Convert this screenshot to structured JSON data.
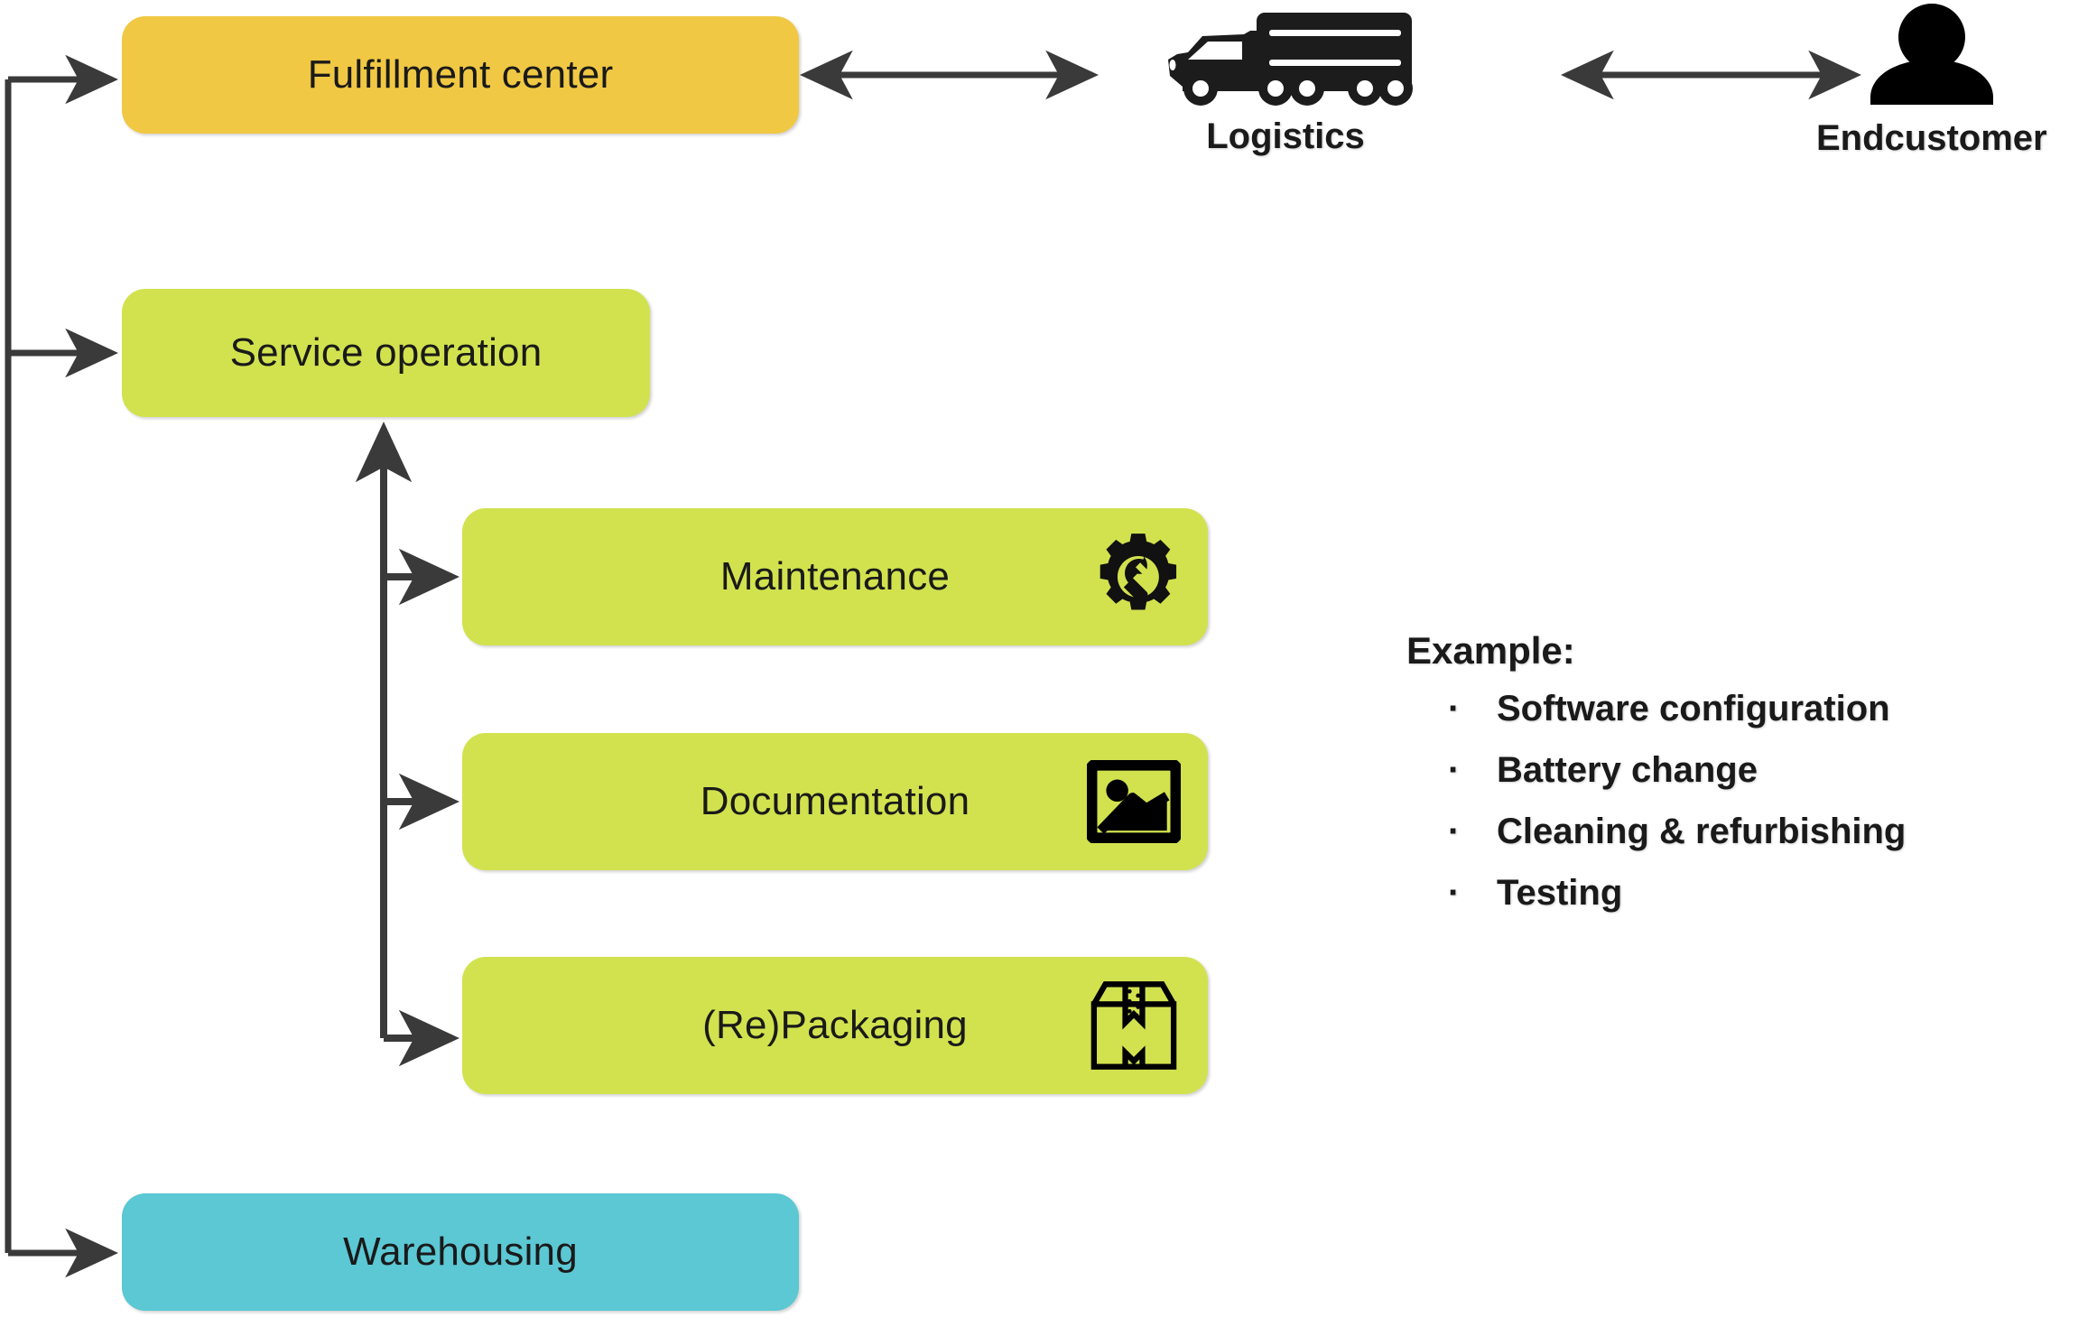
{
  "diagram": {
    "nodes": {
      "fulfillment_center": {
        "label": "Fulfillment center",
        "color": "#F0C843"
      },
      "service_operation": {
        "label": "Service operation",
        "color": "#D2E24E"
      },
      "maintenance": {
        "label": "Maintenance",
        "color": "#D2E24E",
        "icon": "gear-wrench-icon"
      },
      "documentation": {
        "label": "Documentation",
        "color": "#D2E24E",
        "icon": "image-frame-icon"
      },
      "repackaging": {
        "label": "(Re)Packaging",
        "color": "#D2E24E",
        "icon": "cardboard-box-icon"
      },
      "warehousing": {
        "label": "Warehousing",
        "color": "#5BC8D4"
      }
    },
    "actors": {
      "logistics": {
        "label": "Logistics",
        "icon": "truck-icon"
      },
      "endcustomer": {
        "label": "Endcustomer",
        "icon": "person-icon"
      }
    },
    "example": {
      "title": "Example:",
      "bullet": "·",
      "items": [
        "Software configuration",
        "Battery change",
        "Cleaning & refurbishing",
        "Testing"
      ]
    },
    "connector_color": "#3a3a3a"
  }
}
